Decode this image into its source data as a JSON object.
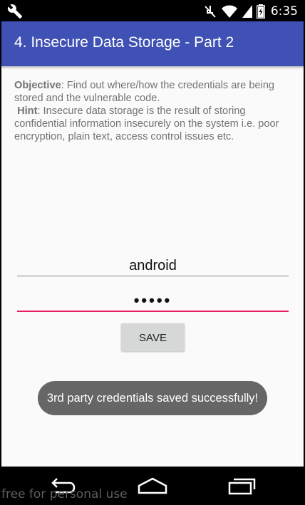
{
  "status_bar": {
    "time": "6:35",
    "icons": [
      "wrench-icon",
      "mute-icon",
      "wifi-icon",
      "signal-icon",
      "battery-icon"
    ]
  },
  "app_bar": {
    "title": "4. Insecure Data Storage - Part 2",
    "color": "#3f51b5"
  },
  "description": {
    "objective_label": "Objective",
    "objective_text": ": Find out where/how the credentials are being stored and the vulnerable code.",
    "hint_label": "Hint",
    "hint_text": ": Insecure data storage is the result of storing confidential information insecurely on the system i.e. poor encryption, plain text, access control issues etc."
  },
  "form": {
    "username_value": "android",
    "password_value": "•••••",
    "save_label": "SAVE",
    "focus_color": "#e91e63"
  },
  "toast": {
    "message": "3rd party credentials saved successfully!"
  },
  "nav_bar": {
    "buttons": [
      "back-icon",
      "home-icon",
      "recents-icon"
    ]
  },
  "watermark": "free for personal use"
}
